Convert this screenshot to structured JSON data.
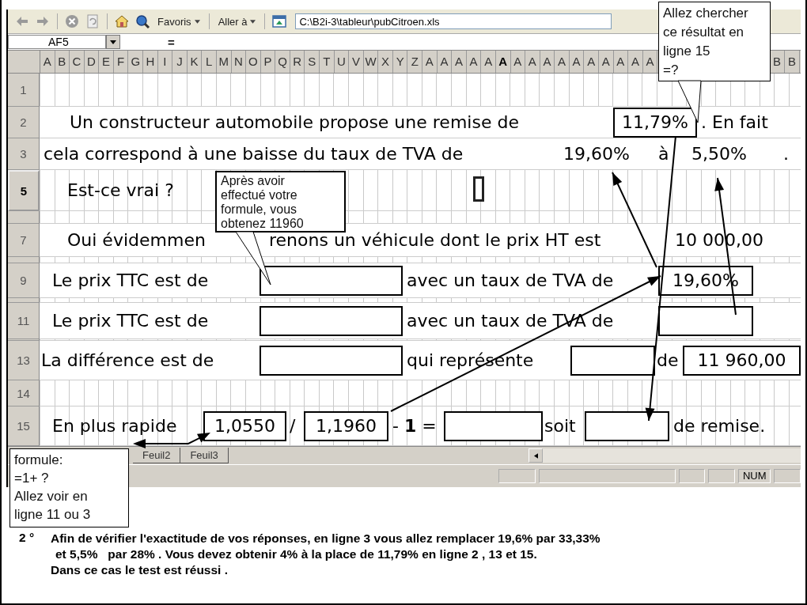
{
  "toolbar": {
    "menus": [
      {
        "label": "Favoris"
      },
      {
        "label": "Aller à"
      }
    ],
    "address": "C:\\B2i-3\\tableur\\pubCitroen.xls"
  },
  "formula_bar": {
    "name_box": "AF5",
    "equals": "="
  },
  "column_headers": {
    "left": [
      {
        "label": "A",
        "selected": false
      },
      {
        "label": "B",
        "selected": false
      },
      {
        "label": "C",
        "selected": false
      },
      {
        "label": "D",
        "selected": false
      },
      {
        "label": "E",
        "selected": false
      },
      {
        "label": "F",
        "selected": false
      },
      {
        "label": "G",
        "selected": false
      },
      {
        "label": "H",
        "selected": false
      },
      {
        "label": "I",
        "selected": false
      },
      {
        "label": "J",
        "selected": false
      },
      {
        "label": "K",
        "selected": false
      },
      {
        "label": "L",
        "selected": false
      },
      {
        "label": "M",
        "selected": false
      },
      {
        "label": "N",
        "selected": false
      },
      {
        "label": "O",
        "selected": false
      },
      {
        "label": "P",
        "selected": false
      },
      {
        "label": "Q",
        "selected": false
      },
      {
        "label": "R",
        "selected": false
      },
      {
        "label": "S",
        "selected": false
      },
      {
        "label": "T",
        "selected": false
      },
      {
        "label": "U",
        "selected": false
      },
      {
        "label": "V",
        "selected": false
      },
      {
        "label": "W",
        "selected": false
      },
      {
        "label": "X",
        "selected": false
      },
      {
        "label": "Y",
        "selected": false
      },
      {
        "label": "Z",
        "selected": false
      },
      {
        "label": "A",
        "selected": false
      },
      {
        "label": "A",
        "selected": false
      },
      {
        "label": "A",
        "selected": false
      },
      {
        "label": "A",
        "selected": false
      },
      {
        "label": "A",
        "selected": false
      },
      {
        "label": "A",
        "selected": true
      },
      {
        "label": "A",
        "selected": false
      },
      {
        "label": "A",
        "selected": false
      },
      {
        "label": "A",
        "selected": false
      },
      {
        "label": "A",
        "selected": false
      },
      {
        "label": "A",
        "selected": false
      },
      {
        "label": "A",
        "selected": false
      },
      {
        "label": "A",
        "selected": false
      },
      {
        "label": "A",
        "selected": false
      },
      {
        "label": "A",
        "selected": false
      },
      {
        "label": "A",
        "selected": false
      }
    ],
    "right": [
      {
        "label": "B",
        "selected": false
      },
      {
        "label": "B",
        "selected": false
      }
    ]
  },
  "rows": [
    {
      "number": "1",
      "selected": false,
      "merged": false
    },
    {
      "number": "2",
      "selected": false,
      "merged": true,
      "items": [
        {
          "kind": "text",
          "text": "Un constructeur automobile propose une remise de"
        },
        {
          "kind": "boxed",
          "text": "11,79%"
        },
        {
          "kind": "text",
          "text": ". En fait"
        }
      ]
    },
    {
      "number": "3",
      "selected": false,
      "merged": true,
      "items": [
        {
          "kind": "text",
          "text": "cela correspond à une baisse du taux de TVA de"
        },
        {
          "kind": "value",
          "text": "19,60%"
        },
        {
          "kind": "text",
          "text": "à"
        },
        {
          "kind": "value",
          "text": "5,50%"
        },
        {
          "kind": "text",
          "text": "."
        }
      ]
    },
    {
      "number": "5",
      "selected": true,
      "merged": false,
      "items": [
        {
          "kind": "text",
          "text": "Est-ce vrai ?"
        }
      ]
    },
    {
      "number": "7",
      "selected": false,
      "merged": true,
      "items": [
        {
          "kind": "text",
          "text": "Oui évidemmen"
        },
        {
          "kind": "text",
          "text": "renons un véhicule dont le prix HT est"
        },
        {
          "kind": "value",
          "text": "10 000,00"
        }
      ]
    },
    {
      "number": "9",
      "selected": false,
      "merged": true,
      "items": [
        {
          "kind": "text",
          "text": "Le prix TTC est de"
        },
        {
          "kind": "blank"
        },
        {
          "kind": "text",
          "text": "avec un taux de TVA de"
        },
        {
          "kind": "boxed",
          "text": "19,60%"
        }
      ]
    },
    {
      "number": "11",
      "selected": false,
      "merged": true,
      "items": [
        {
          "kind": "text",
          "text": "Le prix TTC est de"
        },
        {
          "kind": "blank"
        },
        {
          "kind": "text",
          "text": "avec un taux de TVA de"
        },
        {
          "kind": "blank"
        }
      ]
    },
    {
      "number": "13",
      "selected": false,
      "merged": true,
      "items": [
        {
          "kind": "text",
          "text": "La différence est de"
        },
        {
          "kind": "blank"
        },
        {
          "kind": "text",
          "text": "qui représente"
        },
        {
          "kind": "blank"
        },
        {
          "kind": "text",
          "text": "de"
        },
        {
          "kind": "boxed",
          "text": "11 960,00"
        }
      ]
    },
    {
      "number": "14",
      "selected": false,
      "merged": false
    },
    {
      "number": "15",
      "selected": false,
      "merged": false,
      "items": [
        {
          "kind": "text",
          "text": "En plus rapide"
        },
        {
          "kind": "boxed",
          "text": "1,0550"
        },
        {
          "kind": "text",
          "text": "/"
        },
        {
          "kind": "boxed",
          "text": "1,1960"
        },
        {
          "kind": "text",
          "text": "- **1** ="
        },
        {
          "kind": "blank"
        },
        {
          "kind": "text",
          "text": "soit"
        },
        {
          "kind": "blank"
        },
        {
          "kind": "text",
          "text": "de remise."
        }
      ]
    }
  ],
  "sheet_tabs": [
    {
      "label": "Feuil2"
    },
    {
      "label": "Feuil3"
    }
  ],
  "status_bar": {
    "indicator": "NUM"
  },
  "callouts": [
    {
      "lines": [
        "Allez chercher",
        "ce résultat en",
        "ligne 15",
        "=?"
      ]
    },
    {
      "lines": [
        "Après avoir",
        "effectué votre",
        "formule, vous",
        "obtenez 11960"
      ]
    },
    {
      "lines": [
        "formule:",
        "=1+ ?",
        "Allez voir en",
        "ligne 11 ou 3"
      ]
    }
  ],
  "instructions": {
    "number": "2 °",
    "lines": [
      "Afin de vérifier l'exactitude de vos réponses, en ligne 3 vous allez remplacer 19,6% par 33,33%",
      "et 5,5%   par 28% . Vous devez obtenir 4% à la place de 11,79% en ligne 2 , 13 et 15.",
      "Dans ce cas le test est réussi ."
    ]
  }
}
